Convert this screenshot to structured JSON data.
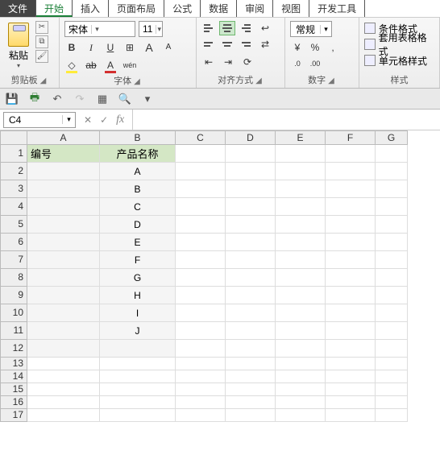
{
  "tabs": {
    "file": "文件",
    "items": [
      "开始",
      "插入",
      "页面布局",
      "公式",
      "数据",
      "审阅",
      "视图",
      "开发工具"
    ],
    "activeIndex": 0
  },
  "ribbon": {
    "clipboard": {
      "paste": "粘贴",
      "label": "剪贴板"
    },
    "font": {
      "name": "宋体",
      "size": "11",
      "growA": "A",
      "shrinkA": "A",
      "bold": "B",
      "italic": "I",
      "underline": "U",
      "strike": "ab",
      "fontA": "A",
      "wen": "wén",
      "label": "字体"
    },
    "align": {
      "label": "对齐方式"
    },
    "number": {
      "format": "常规",
      "currency": "¥",
      "percent": "%",
      "comma": ",",
      "inc": ".0",
      "dec": ".00",
      "label": "数字"
    },
    "styles": {
      "cond": "条件格式",
      "table": "套用表格格式",
      "cell": "单元格样式",
      "label": "样式"
    }
  },
  "nameBox": "C4",
  "formula": "",
  "columns": [
    "A",
    "B",
    "C",
    "D",
    "E",
    "F",
    "G"
  ],
  "sheet": {
    "headerRow": {
      "a": "编号",
      "b": "产品名称"
    },
    "rows": [
      {
        "n": "1"
      },
      {
        "n": "2",
        "b": "A"
      },
      {
        "n": "3",
        "b": "B"
      },
      {
        "n": "4",
        "b": "C"
      },
      {
        "n": "5",
        "b": "D"
      },
      {
        "n": "6",
        "b": "E"
      },
      {
        "n": "7",
        "b": "F"
      },
      {
        "n": "8",
        "b": "G"
      },
      {
        "n": "9",
        "b": "H"
      },
      {
        "n": "10",
        "b": "I"
      },
      {
        "n": "11",
        "b": "J"
      },
      {
        "n": "12"
      },
      {
        "n": "13"
      },
      {
        "n": "14"
      },
      {
        "n": "15"
      },
      {
        "n": "16"
      },
      {
        "n": "17"
      }
    ]
  }
}
